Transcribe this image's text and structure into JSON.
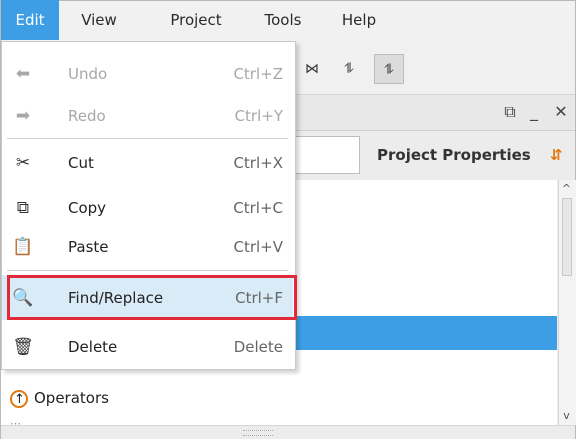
{
  "menubar": {
    "items": [
      {
        "label": "Edit",
        "active": true
      },
      {
        "label": "View"
      },
      {
        "label": "Project"
      },
      {
        "label": "Tools"
      },
      {
        "label": "Help"
      }
    ]
  },
  "toolbar": {
    "buttons": [
      {
        "icon": "align-icon",
        "glyph": "⋈"
      },
      {
        "icon": "sort-icon",
        "glyph": "⥮"
      },
      {
        "icon": "sort-pressed-icon",
        "glyph": "⥮"
      }
    ]
  },
  "panel": {
    "window_controls": {
      "restore": "⧉",
      "minimize": "_",
      "close": "✕"
    },
    "tab_label": "Project Properties",
    "tab_icon_glyph": "⇵"
  },
  "tree": {
    "rows": [
      {
        "label": "Operators"
      }
    ],
    "partial_row_top": "⋯",
    "scroll_up": "^",
    "scroll_down": "v"
  },
  "edit_menu": {
    "items": [
      {
        "label": "Undo",
        "shortcut": "Ctrl+Z",
        "icon": "undo-icon",
        "glyph": "⬅",
        "disabled": true
      },
      {
        "label": "Redo",
        "shortcut": "Ctrl+Y",
        "icon": "redo-icon",
        "glyph": "➡",
        "disabled": true
      },
      {
        "label": "Cut",
        "shortcut": "Ctrl+X",
        "icon": "scissors-icon",
        "glyph": "✂"
      },
      {
        "label": "Copy",
        "shortcut": "Ctrl+C",
        "icon": "copy-icon",
        "glyph": "⧉"
      },
      {
        "label": "Paste",
        "shortcut": "Ctrl+V",
        "icon": "clipboard-icon",
        "glyph": "📋"
      },
      {
        "label": "Find/Replace",
        "shortcut": "Ctrl+F",
        "icon": "find-replace-icon",
        "glyph": "🔍",
        "hover": true
      },
      {
        "label": "Delete",
        "shortcut": "Delete",
        "icon": "trash-icon",
        "glyph": "🗑"
      }
    ]
  }
}
